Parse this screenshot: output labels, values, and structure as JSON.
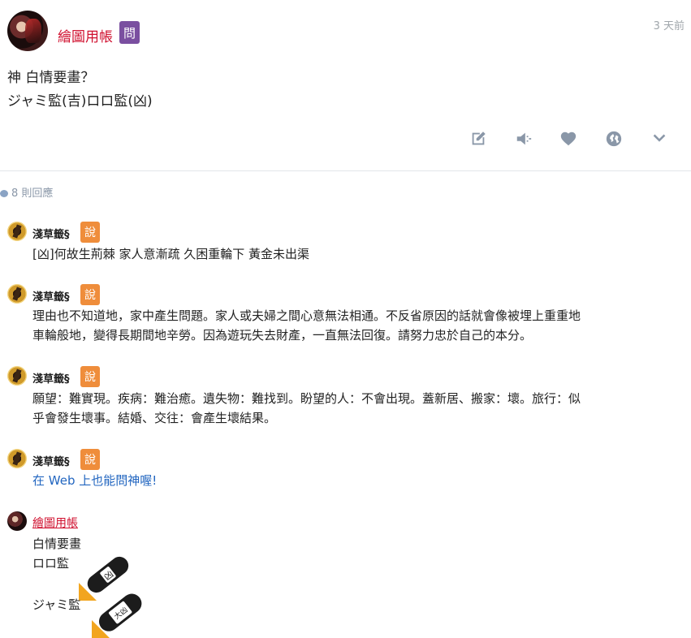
{
  "post": {
    "author": "繪圖用帳",
    "badge": "問",
    "time": "3 天前",
    "lines": [
      "神 白情要畫？",
      "ジャミ監(吉)ロロ監(凶)"
    ]
  },
  "actions": [
    {
      "name": "edit-icon"
    },
    {
      "name": "speaker-icon"
    },
    {
      "name": "heart-icon"
    },
    {
      "name": "share-icon"
    },
    {
      "name": "chevron-down-icon"
    }
  ],
  "replies": {
    "count_label": "8 則回應"
  },
  "comments": [
    {
      "author": "淺草籤§",
      "badge": "說",
      "text": [
        "[凶]何故生荊棘 家人意漸疏 久困重輪下 黃金未出渠"
      ]
    },
    {
      "author": "淺草籤§",
      "badge": "說",
      "text": [
        "理由也不知道地，家中產生問題。家人或夫婦之間心意無法相通。不反省原因的話就會像被埋上重重地",
        "車輪般地，變得長期間地辛勞。因為遊玩失去財產，一直無法回復。請努力忠於自己的本分。"
      ]
    },
    {
      "author": "淺草籤§",
      "badge": "說",
      "text": [
        "願望：難實現。疾病：難治癒。遺失物：難找到。盼望的人：不會出現。蓋新居、搬家：壞。旅行：似",
        "乎會發生壞事。結婚、交往：會產生壞結果。"
      ]
    },
    {
      "author": "淺草籤§",
      "badge": "說",
      "text": [
        "在 Web 上也能問神喔!"
      ]
    }
  ],
  "self_comment": {
    "author": "繪圖用帳",
    "lines": [
      "白情要畫",
      "ロロ監",
      "ジャミ監"
    ],
    "stamps": [
      "凶",
      "大凶"
    ]
  },
  "colors": {
    "author_red": "#d0102f",
    "ask_badge": "#7a4fa0",
    "say_badge": "#ef8d3b",
    "icon_gray": "#8a97a8",
    "link_blue": "#2266c0"
  }
}
